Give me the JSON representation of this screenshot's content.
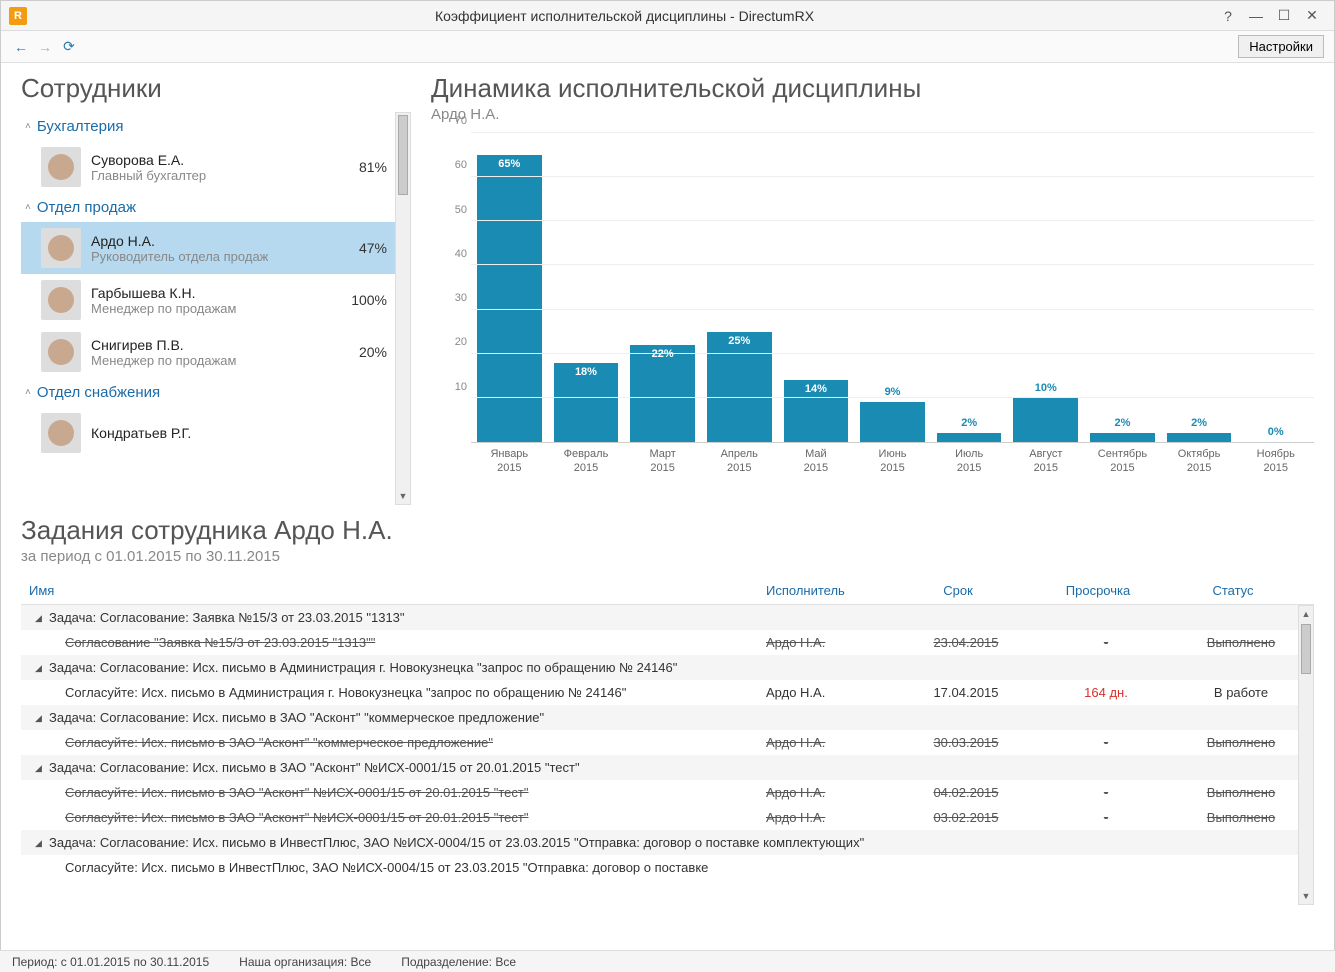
{
  "window": {
    "title": "Коэффициент исполнительской дисциплины - DirectumRX",
    "settings_btn": "Настройки"
  },
  "employees": {
    "title": "Сотрудники",
    "departments": [
      {
        "name": "Бухгалтерия",
        "people": [
          {
            "name": "Суворова Е.А.",
            "role": "Главный бухгалтер",
            "pct": "81%"
          }
        ]
      },
      {
        "name": "Отдел продаж",
        "people": [
          {
            "name": "Ардо Н.А.",
            "role": "Руководитель отдела продаж",
            "pct": "47%",
            "selected": true
          },
          {
            "name": "Гарбышева К.Н.",
            "role": "Менеджер по продажам",
            "pct": "100%"
          },
          {
            "name": "Снигирев П.В.",
            "role": "Менеджер по продажам",
            "pct": "20%"
          }
        ]
      },
      {
        "name": "Отдел снабжения",
        "people": [
          {
            "name": "Кондратьев Р.Г.",
            "role": "",
            "pct": ""
          }
        ]
      }
    ]
  },
  "chart": {
    "title": "Динамика исполнительской дисциплины",
    "subtitle": "Ардо Н.А."
  },
  "chart_data": {
    "type": "bar",
    "title": "Динамика исполнительской дисциплины",
    "ylabel": "",
    "xlabel": "",
    "ylim": [
      0,
      70
    ],
    "y_ticks": [
      10,
      20,
      30,
      40,
      50,
      60,
      70
    ],
    "categories": [
      "Январь 2015",
      "Февраль 2015",
      "Март 2015",
      "Апрель 2015",
      "Май 2015",
      "Июнь 2015",
      "Июль 2015",
      "Август 2015",
      "Сентябрь 2015",
      "Октябрь 2015",
      "Ноябрь 2015"
    ],
    "values": [
      65,
      18,
      22,
      25,
      14,
      9,
      2,
      10,
      2,
      2,
      0
    ],
    "value_labels": [
      "65%",
      "18%",
      "22%",
      "25%",
      "14%",
      "9%",
      "2%",
      "10%",
      "2%",
      "2%",
      "0%"
    ]
  },
  "tasks": {
    "title": "Задания сотрудника Ардо Н.А.",
    "subtitle": "за период с 01.01.2015 по 30.11.2015",
    "columns": {
      "name": "Имя",
      "exec": "Исполнитель",
      "date": "Срок",
      "over": "Просрочка",
      "status": "Статус"
    },
    "rows": [
      {
        "type": "group",
        "name": "Задача: Согласование: Заявка №15/3 от 23.03.2015 \"1313\""
      },
      {
        "type": "item",
        "strike": true,
        "name": "Согласование \"Заявка №15/3 от 23.03.2015 \"1313\"\"",
        "exec": "Ардо Н.А.",
        "date": "23.04.2015",
        "over": "-",
        "status": "Выполнено"
      },
      {
        "type": "group",
        "name": "Задача: Согласование: Исх. письмо в Администрация г. Новокузнецка \"запрос по обращению № 24146\""
      },
      {
        "type": "item",
        "strike": false,
        "name": "Согласуйте: Исх. письмо в Администрация г. Новокузнецка \"запрос по обращению № 24146\"",
        "exec": "Ардо Н.А.",
        "date": "17.04.2015",
        "over": "164 дн.",
        "over_red": true,
        "status": "В работе"
      },
      {
        "type": "group",
        "name": "Задача: Согласование: Исх. письмо в ЗАО \"Асконт\" \"коммерческое предложение\""
      },
      {
        "type": "item",
        "strike": true,
        "name": "Согласуйте: Исх. письмо в ЗАО \"Асконт\" \"коммерческое предложение\"",
        "exec": "Ардо Н.А.",
        "date": "30.03.2015",
        "over": "-",
        "status": "Выполнено"
      },
      {
        "type": "group",
        "name": "Задача: Согласование: Исх. письмо в ЗАО \"Асконт\" №ИСХ-0001/15 от 20.01.2015 \"тест\""
      },
      {
        "type": "item",
        "strike": true,
        "name": "Согласуйте: Исх. письмо в ЗАО \"Асконт\" №ИСХ-0001/15 от 20.01.2015 \"тест\"",
        "exec": "Ардо Н.А.",
        "date": "04.02.2015",
        "over": "-",
        "status": "Выполнено"
      },
      {
        "type": "item",
        "strike": true,
        "name": "Согласуйте: Исх. письмо в ЗАО \"Асконт\" №ИСХ-0001/15 от 20.01.2015 \"тест\"",
        "exec": "Ардо Н.А.",
        "date": "03.02.2015",
        "over": "-",
        "status": "Выполнено"
      },
      {
        "type": "group",
        "name": "Задача: Согласование: Исх. письмо в ИнвестПлюс, ЗАО №ИСХ-0004/15 от 23.03.2015 \"Отправка: договор о поставке комплектующих\""
      },
      {
        "type": "item",
        "strike": false,
        "name": "Согласуйте: Исх. письмо в ИнвестПлюс, ЗАО №ИСХ-0004/15 от 23.03.2015 \"Отправка: договор о поставке",
        "exec": "",
        "date": "",
        "over": "",
        "status": ""
      }
    ]
  },
  "statusbar": {
    "period": "Период: с 01.01.2015 по 30.11.2015",
    "org": "Наша организация: Все",
    "dept": "Подразделение: Все"
  }
}
